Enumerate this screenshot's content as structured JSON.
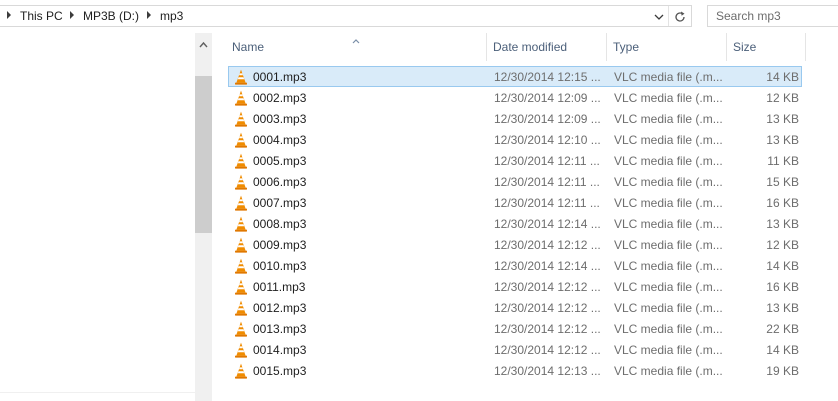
{
  "breadcrumb": {
    "items": [
      "This PC",
      "MP3B (D:)",
      "mp3"
    ]
  },
  "search": {
    "placeholder": "Search mp3"
  },
  "columns": {
    "name": "Name",
    "date_modified": "Date modified",
    "type": "Type",
    "size": "Size"
  },
  "sort": {
    "column": "Name",
    "direction": "ascending"
  },
  "icons": {
    "file": "vlc-cone-icon",
    "refresh": "refresh-icon",
    "dropdown": "chevron-down-icon",
    "scroll_up": "chevron-up-icon",
    "crumb_separator": "chevron-right-icon"
  },
  "colors": {
    "selection_fill": "#d9ebf9",
    "selection_border": "#99c9ef",
    "header_text": "#4c607a",
    "secondary_text": "#6d6d6d",
    "vlc_orange": "#f08c00"
  },
  "files": [
    {
      "name": "0001.mp3",
      "date": "12/30/2014 12:15 ...",
      "type": "VLC media file (.m...",
      "size": "14 KB",
      "selected": true
    },
    {
      "name": "0002.mp3",
      "date": "12/30/2014 12:09 ...",
      "type": "VLC media file (.m...",
      "size": "12 KB",
      "selected": false
    },
    {
      "name": "0003.mp3",
      "date": "12/30/2014 12:09 ...",
      "type": "VLC media file (.m...",
      "size": "13 KB",
      "selected": false
    },
    {
      "name": "0004.mp3",
      "date": "12/30/2014 12:10 ...",
      "type": "VLC media file (.m...",
      "size": "13 KB",
      "selected": false
    },
    {
      "name": "0005.mp3",
      "date": "12/30/2014 12:11 ...",
      "type": "VLC media file (.m...",
      "size": "11 KB",
      "selected": false
    },
    {
      "name": "0006.mp3",
      "date": "12/30/2014 12:11 ...",
      "type": "VLC media file (.m...",
      "size": "15 KB",
      "selected": false
    },
    {
      "name": "0007.mp3",
      "date": "12/30/2014 12:11 ...",
      "type": "VLC media file (.m...",
      "size": "16 KB",
      "selected": false
    },
    {
      "name": "0008.mp3",
      "date": "12/30/2014 12:14 ...",
      "type": "VLC media file (.m...",
      "size": "13 KB",
      "selected": false
    },
    {
      "name": "0009.mp3",
      "date": "12/30/2014 12:12 ...",
      "type": "VLC media file (.m...",
      "size": "12 KB",
      "selected": false
    },
    {
      "name": "0010.mp3",
      "date": "12/30/2014 12:14 ...",
      "type": "VLC media file (.m...",
      "size": "14 KB",
      "selected": false
    },
    {
      "name": "0011.mp3",
      "date": "12/30/2014 12:12 ...",
      "type": "VLC media file (.m...",
      "size": "16 KB",
      "selected": false
    },
    {
      "name": "0012.mp3",
      "date": "12/30/2014 12:12 ...",
      "type": "VLC media file (.m...",
      "size": "13 KB",
      "selected": false
    },
    {
      "name": "0013.mp3",
      "date": "12/30/2014 12:12 ...",
      "type": "VLC media file (.m...",
      "size": "22 KB",
      "selected": false
    },
    {
      "name": "0014.mp3",
      "date": "12/30/2014 12:12 ...",
      "type": "VLC media file (.m...",
      "size": "14 KB",
      "selected": false
    },
    {
      "name": "0015.mp3",
      "date": "12/30/2014 12:13 ...",
      "type": "VLC media file (.m...",
      "size": "19 KB",
      "selected": false
    }
  ]
}
